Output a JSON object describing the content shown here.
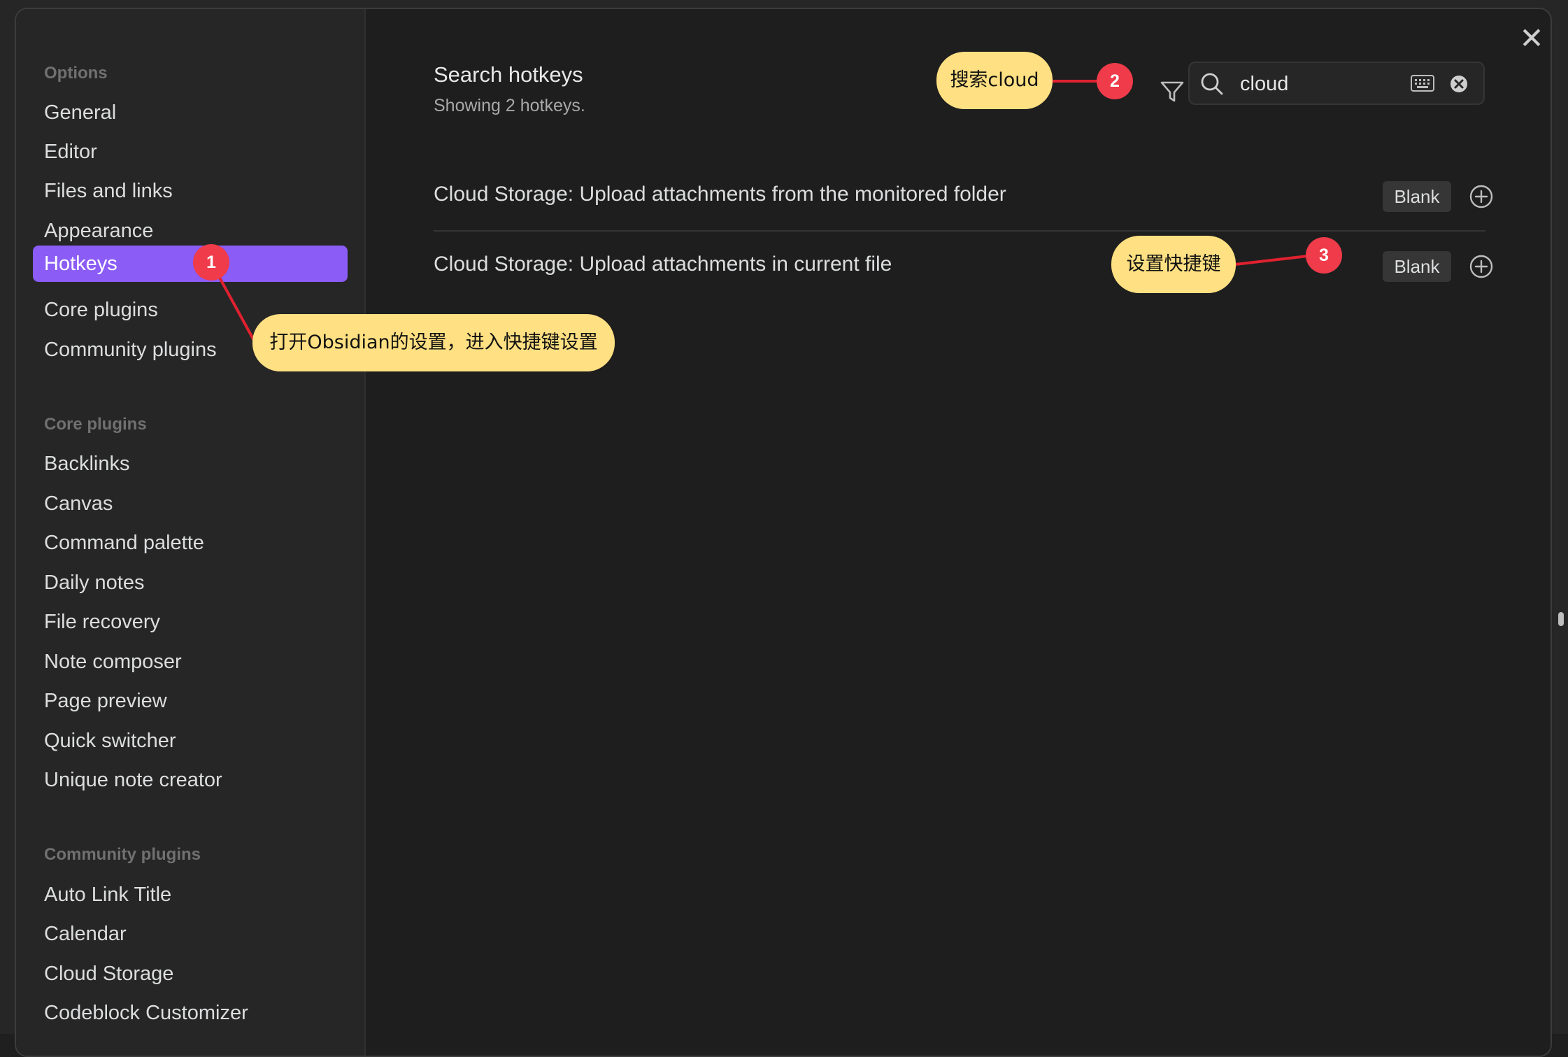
{
  "sidebar": {
    "options_title": "Options",
    "options_items": [
      {
        "label": "General"
      },
      {
        "label": "Editor"
      },
      {
        "label": "Files and links"
      },
      {
        "label": "Appearance"
      },
      {
        "label": "Hotkeys"
      },
      {
        "label": "Core plugins"
      },
      {
        "label": "Community plugins"
      }
    ],
    "core_title": "Core plugins",
    "core_items": [
      {
        "label": "Backlinks"
      },
      {
        "label": "Canvas"
      },
      {
        "label": "Command palette"
      },
      {
        "label": "Daily notes"
      },
      {
        "label": "File recovery"
      },
      {
        "label": "Note composer"
      },
      {
        "label": "Page preview"
      },
      {
        "label": "Quick switcher"
      },
      {
        "label": "Unique note creator"
      }
    ],
    "community_title": "Community plugins",
    "community_items": [
      {
        "label": "Auto Link Title"
      },
      {
        "label": "Calendar"
      },
      {
        "label": "Cloud Storage"
      },
      {
        "label": "Codeblock Customizer"
      }
    ],
    "active_item": "Hotkeys"
  },
  "main": {
    "title": "Search hotkeys",
    "subtitle": "Showing 2 hotkeys.",
    "search": {
      "value": "cloud",
      "placeholder": ""
    },
    "hotkeys": [
      {
        "name": "Cloud Storage: Upload attachments from the monitored folder",
        "binding": "Blank"
      },
      {
        "name": "Cloud Storage: Upload attachments in current file",
        "binding": "Blank"
      }
    ]
  },
  "annotations": [
    {
      "num": "1",
      "text": "打开Obsidian的设置，进入快捷键设置"
    },
    {
      "num": "2",
      "text": "搜索cloud"
    },
    {
      "num": "3",
      "text": "设置快捷键"
    }
  ],
  "icons": {
    "close": "close-icon",
    "filter": "filter-icon",
    "search": "search-icon",
    "keyboard": "keyboard-icon",
    "clear": "clear-search-icon",
    "add": "add-hotkey-icon"
  },
  "colors": {
    "accent": "#8b5cf6",
    "callout": "#ffe082",
    "badge": "#ef3b4a",
    "line": "#e0212f"
  }
}
